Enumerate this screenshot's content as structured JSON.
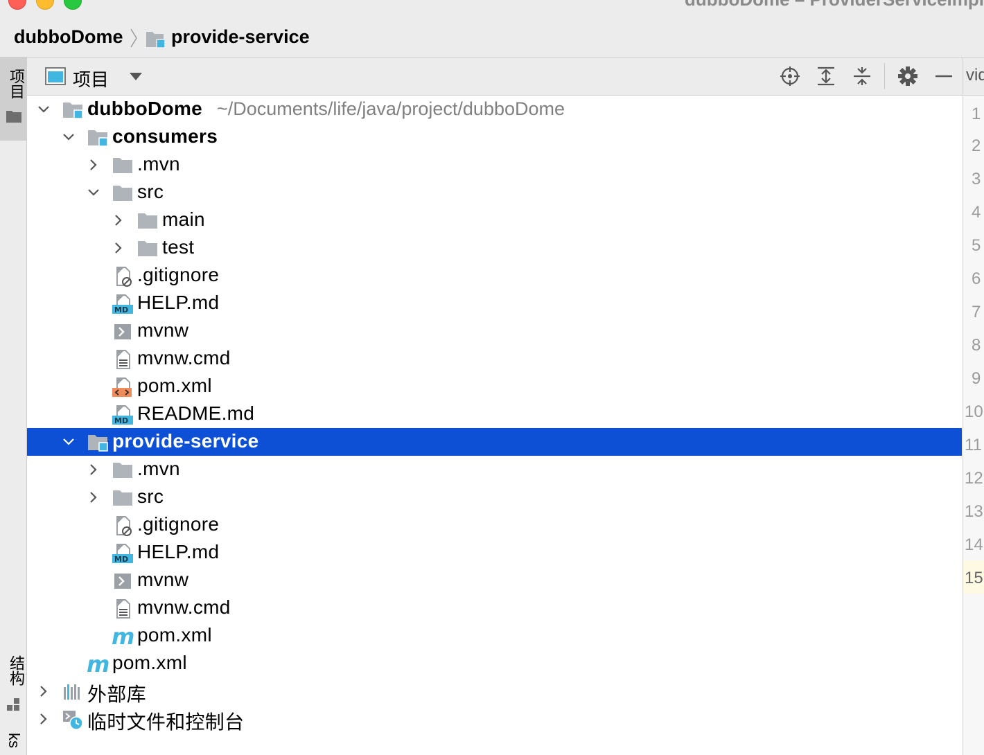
{
  "window": {
    "title": "dubboDome – ProviderServiceImpl"
  },
  "breadcrumb": {
    "project": "dubboDome",
    "module": "provide-service"
  },
  "tool_strip": {
    "project_tab": "项目",
    "structure_tab": "结构",
    "bookmarks_tab": "ks"
  },
  "panel": {
    "title": "项目",
    "icons": [
      "locate-icon",
      "expand-all-icon",
      "collapse-all-icon",
      "gear-icon",
      "minimize-icon"
    ]
  },
  "tree": {
    "root": {
      "label": "dubboDome",
      "path": "~/Documents/life/java/project/dubboDome"
    },
    "consumers": {
      "label": "consumers",
      "mvn": ".mvn",
      "src": "src",
      "main": "main",
      "test": "test",
      "gitignore": ".gitignore",
      "help": "HELP.md",
      "mvnw": "mvnw",
      "mvnw_cmd": "mvnw.cmd",
      "pom": "pom.xml",
      "readme": "README.md"
    },
    "provide_service": {
      "label": "provide-service",
      "mvn": ".mvn",
      "src": "src",
      "gitignore": ".gitignore",
      "help": "HELP.md",
      "mvnw": "mvnw",
      "mvnw_cmd": "mvnw.cmd",
      "pom": "pom.xml"
    },
    "root_pom": "pom.xml",
    "external_libraries": "外部库",
    "scratches": "临时文件和控制台"
  },
  "editor": {
    "tab_fragment": "vid",
    "line_numbers": [
      "1",
      "2",
      "3",
      "4",
      "5",
      "6",
      "7",
      "8",
      "9",
      "10",
      "11",
      "12",
      "13",
      "14",
      "15"
    ],
    "current_line": "15"
  },
  "colors": {
    "selection": "#0d50d6",
    "accent_blue": "#40b6e0",
    "folder_gray": "#aeb4ba"
  }
}
